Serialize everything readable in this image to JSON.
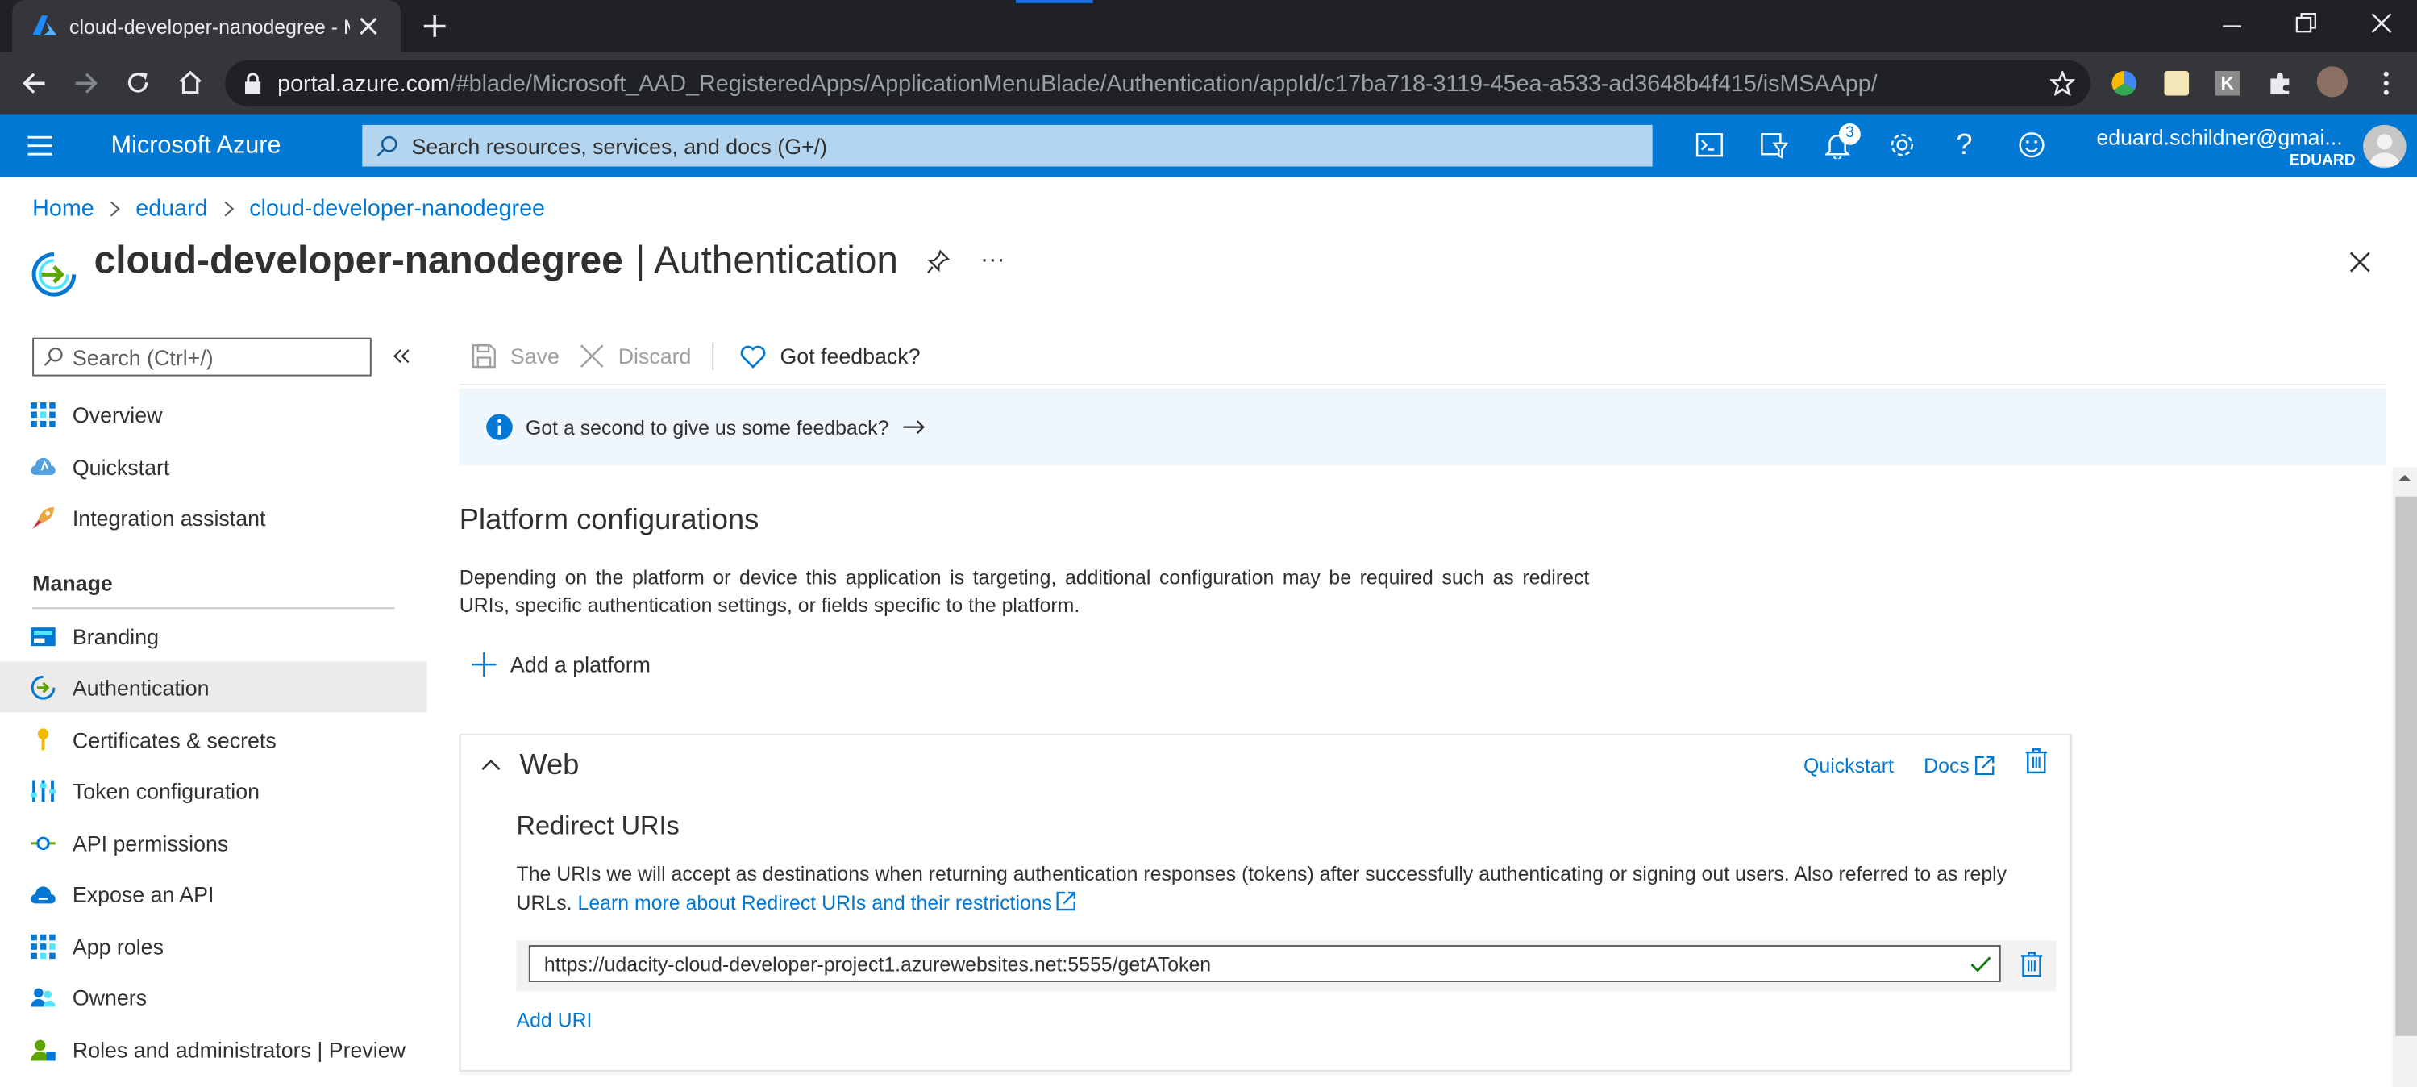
{
  "browser": {
    "tab_title": "cloud-developer-nanodegree - Microsoft Azure",
    "url_host": "portal.azure.com",
    "url_path": "/#blade/Microsoft_AAD_RegisteredApps/ApplicationMenuBlade/Authentication/appId/c17ba718-3119-45ea-a533-ad3648b4f415/isMSAApp/"
  },
  "azure_bar": {
    "brand": "Microsoft Azure",
    "search_placeholder": "Search resources, services, and docs (G+/)",
    "notification_count": "3",
    "user_email": "eduard.schildner@gmai...",
    "user_directory": "EDUARD"
  },
  "breadcrumb": [
    "Home",
    "eduard",
    "cloud-developer-nanodegree"
  ],
  "page": {
    "app_name": "cloud-developer-nanodegree",
    "section": "| Authentication"
  },
  "sidebar": {
    "search_placeholder": "Search (Ctrl+/)",
    "top_items": [
      "Overview",
      "Quickstart",
      "Integration assistant"
    ],
    "manage_heading": "Manage",
    "manage_items": [
      "Branding",
      "Authentication",
      "Certificates & secrets",
      "Token configuration",
      "API permissions",
      "Expose an API",
      "App roles",
      "Owners",
      "Roles and administrators | Preview"
    ]
  },
  "toolbar": {
    "save": "Save",
    "discard": "Discard",
    "feedback": "Got feedback?"
  },
  "banner": {
    "text": "Got a second to give us some feedback?"
  },
  "platform": {
    "heading": "Platform configurations",
    "description": "Depending on the platform or device this application is targeting, additional configuration may be required such as redirect URIs, specific authentication settings, or fields specific to the platform.",
    "add_platform": "Add a platform"
  },
  "web": {
    "title": "Web",
    "quickstart": "Quickstart",
    "docs": "Docs",
    "redirect_heading": "Redirect URIs",
    "redirect_desc": "The URIs we will accept as destinations when returning authentication responses (tokens) after successfully authenticating or signing out users. Also referred to as reply URLs.",
    "learn_more": "Learn more about Redirect URIs and their restrictions",
    "uri_value": "https://udacity-cloud-developer-project1.azurewebsites.net:5555/getAToken",
    "add_uri": "Add URI"
  },
  "colors": {
    "azure_blue": "#0078d4",
    "selected_nav": "#edebe9",
    "banner_bg": "#eff6fc"
  }
}
